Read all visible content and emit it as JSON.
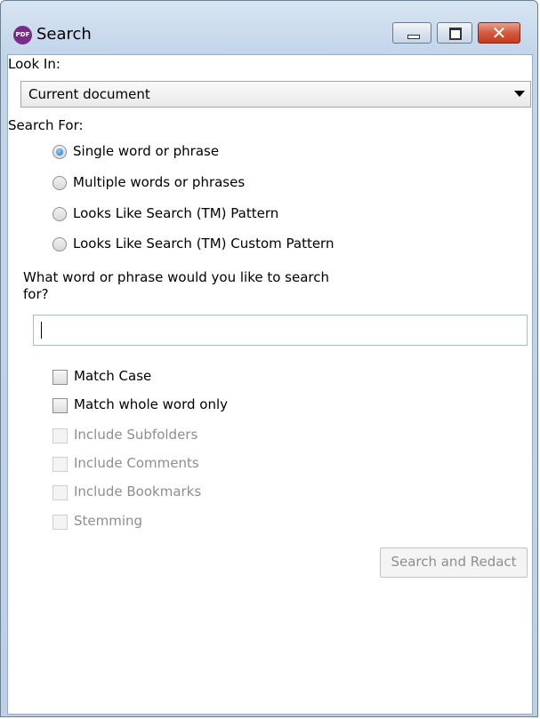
{
  "window": {
    "title": "Search",
    "app_icon_text": "PDF"
  },
  "look_in": {
    "label": "Look In:",
    "value": "Current document"
  },
  "search_for": {
    "label": "Search For:",
    "options": [
      {
        "label": "Single word or phrase",
        "checked": true
      },
      {
        "label": "Multiple words or phrases",
        "checked": false
      },
      {
        "label": "Looks Like Search (TM) Pattern",
        "checked": false
      },
      {
        "label": "Looks Like Search (TM) Custom Pattern",
        "checked": false
      }
    ]
  },
  "query": {
    "label_line1": "What word or phrase would you like to search",
    "label_line2": "for?",
    "value": ""
  },
  "options": [
    {
      "label": "Match Case",
      "enabled": true,
      "checked": false
    },
    {
      "label": "Match whole word only",
      "enabled": true,
      "checked": false
    },
    {
      "label": "Include Subfolders",
      "enabled": false,
      "checked": false
    },
    {
      "label": "Include Comments",
      "enabled": false,
      "checked": false
    },
    {
      "label": "Include Bookmarks",
      "enabled": false,
      "checked": false
    },
    {
      "label": "Stemming",
      "enabled": false,
      "checked": false
    }
  ],
  "actions": {
    "search_and_redact": "Search and Redact"
  }
}
